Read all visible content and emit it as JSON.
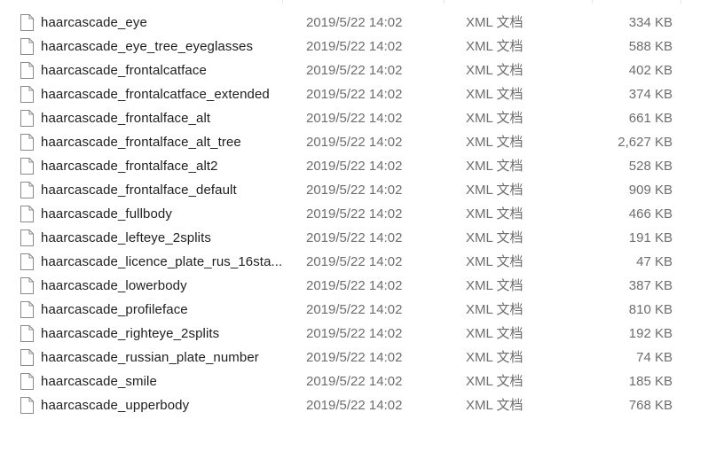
{
  "icons": {
    "file": "file-icon"
  },
  "colors": {
    "name_text": "#1e1e1e",
    "meta_text": "#6d6d6d",
    "hover_row": "#e5f3ff"
  },
  "files": [
    {
      "name": "haarcascade_eye",
      "date": "2019/5/22 14:02",
      "type": "XML 文档",
      "size": "334 KB"
    },
    {
      "name": "haarcascade_eye_tree_eyeglasses",
      "date": "2019/5/22 14:02",
      "type": "XML 文档",
      "size": "588 KB"
    },
    {
      "name": "haarcascade_frontalcatface",
      "date": "2019/5/22 14:02",
      "type": "XML 文档",
      "size": "402 KB"
    },
    {
      "name": "haarcascade_frontalcatface_extended",
      "date": "2019/5/22 14:02",
      "type": "XML 文档",
      "size": "374 KB"
    },
    {
      "name": "haarcascade_frontalface_alt",
      "date": "2019/5/22 14:02",
      "type": "XML 文档",
      "size": "661 KB"
    },
    {
      "name": "haarcascade_frontalface_alt_tree",
      "date": "2019/5/22 14:02",
      "type": "XML 文档",
      "size": "2,627 KB"
    },
    {
      "name": "haarcascade_frontalface_alt2",
      "date": "2019/5/22 14:02",
      "type": "XML 文档",
      "size": "528 KB"
    },
    {
      "name": "haarcascade_frontalface_default",
      "date": "2019/5/22 14:02",
      "type": "XML 文档",
      "size": "909 KB"
    },
    {
      "name": "haarcascade_fullbody",
      "date": "2019/5/22 14:02",
      "type": "XML 文档",
      "size": "466 KB"
    },
    {
      "name": "haarcascade_lefteye_2splits",
      "date": "2019/5/22 14:02",
      "type": "XML 文档",
      "size": "191 KB"
    },
    {
      "name": "haarcascade_licence_plate_rus_16sta...",
      "date": "2019/5/22 14:02",
      "type": "XML 文档",
      "size": "47 KB"
    },
    {
      "name": "haarcascade_lowerbody",
      "date": "2019/5/22 14:02",
      "type": "XML 文档",
      "size": "387 KB"
    },
    {
      "name": "haarcascade_profileface",
      "date": "2019/5/22 14:02",
      "type": "XML 文档",
      "size": "810 KB"
    },
    {
      "name": "haarcascade_righteye_2splits",
      "date": "2019/5/22 14:02",
      "type": "XML 文档",
      "size": "192 KB"
    },
    {
      "name": "haarcascade_russian_plate_number",
      "date": "2019/5/22 14:02",
      "type": "XML 文档",
      "size": "74 KB"
    },
    {
      "name": "haarcascade_smile",
      "date": "2019/5/22 14:02",
      "type": "XML 文档",
      "size": "185 KB"
    },
    {
      "name": "haarcascade_upperbody",
      "date": "2019/5/22 14:02",
      "type": "XML 文档",
      "size": "768 KB"
    }
  ]
}
